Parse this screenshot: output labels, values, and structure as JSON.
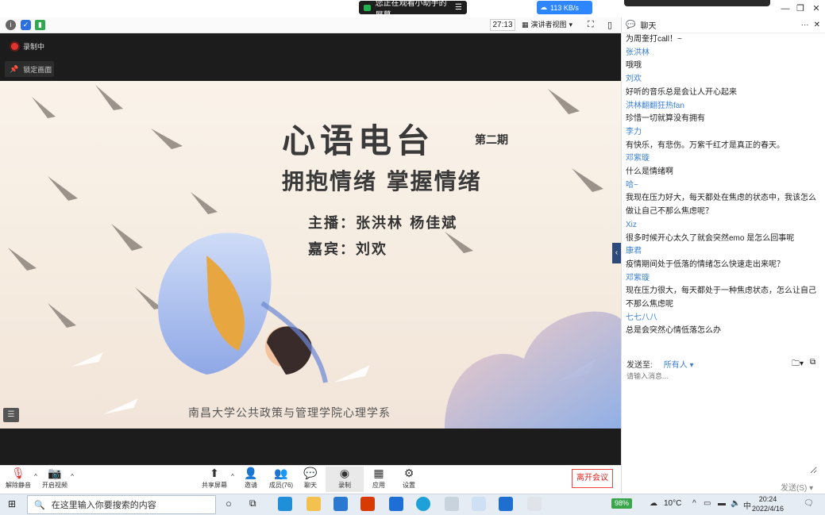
{
  "titlebar": {
    "share_banner": "您正在观看小助手的屏幕",
    "net_speed": "113 KB/s"
  },
  "meetbar": {
    "timer": "27:13",
    "view_mode": "演讲者视图"
  },
  "video": {
    "recording": "录制中",
    "pin_label": "锁定画面"
  },
  "slide": {
    "title": "心语电台",
    "issue": "第二期",
    "subtitle": "拥抱情绪  掌握情绪",
    "hosts": "主播：张洪林  杨佳斌",
    "guest": "嘉宾：刘欢",
    "footer": "南昌大学公共政策与管理学院心理学系"
  },
  "toolbar": {
    "mute": "解除静音",
    "video": "开启视频",
    "share": "共享屏幕",
    "invite": "邀请",
    "members": "成员(76)",
    "chat": "聊天",
    "record": "录制",
    "apps": "应用",
    "settings": "设置",
    "leave": "离开会议"
  },
  "chat": {
    "title": "聊天",
    "messages": [
      {
        "kind": "text",
        "value": "为周奎打call！~"
      },
      {
        "kind": "name",
        "value": "张洪林"
      },
      {
        "kind": "text",
        "value": "哦哦"
      },
      {
        "kind": "name",
        "value": "刘欢"
      },
      {
        "kind": "text",
        "value": "好听的音乐总是会让人开心起来"
      },
      {
        "kind": "name",
        "value": "洪林翻翻狂热fan"
      },
      {
        "kind": "text",
        "value": "珍惜一切就算没有拥有"
      },
      {
        "kind": "name",
        "value": "李力"
      },
      {
        "kind": "text",
        "value": "有快乐，有悲伤。万紫千红才是真正的春天。"
      },
      {
        "kind": "name",
        "value": "邓紫璇"
      },
      {
        "kind": "text",
        "value": "什么是情绪啊"
      },
      {
        "kind": "name",
        "value": "哈~"
      },
      {
        "kind": "text",
        "value": "我现在压力好大，每天都处在焦虑的状态中，我该怎么做让自己不那么焦虑呢？"
      },
      {
        "kind": "name",
        "value": "Xiz"
      },
      {
        "kind": "text",
        "value": "很多时候开心太久了就会突然emo 是怎么回事呢"
      },
      {
        "kind": "name",
        "value": "康君"
      },
      {
        "kind": "text",
        "value": "疫情期间处于低落的情绪怎么快速走出来呢？"
      },
      {
        "kind": "name",
        "value": "邓紫璇"
      },
      {
        "kind": "text",
        "value": "现在压力很大，每天都处于一种焦虑状态，怎么让自己不那么焦虑呢"
      },
      {
        "kind": "name",
        "value": "七七八八"
      },
      {
        "kind": "text",
        "value": "总是会突然心情低落怎么办"
      }
    ],
    "send_to_label": "发送至:",
    "send_to_value": "所有人",
    "input_placeholder": "请输入消息...",
    "send_label": "发送(S)"
  },
  "taskbar": {
    "search_placeholder": "在这里输入你要搜索的内容",
    "battery": "98%",
    "weather": "10°C",
    "ime": "中",
    "time": "20:24",
    "date": "2022/4/16"
  }
}
